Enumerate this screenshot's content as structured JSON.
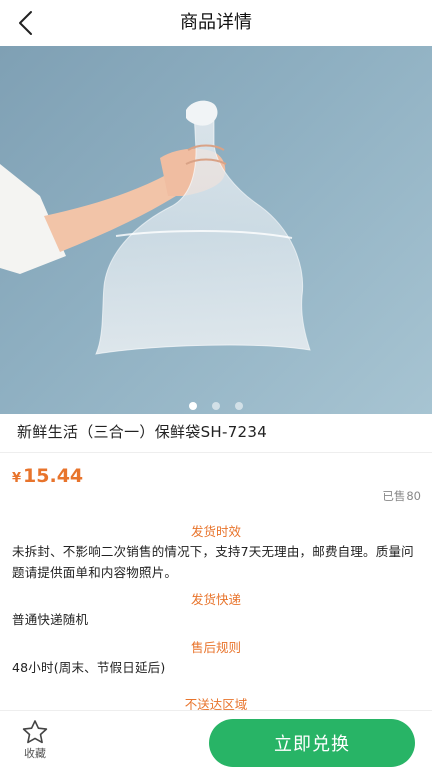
{
  "header": {
    "title": "商品详情",
    "back_icon": "chevron-left-icon"
  },
  "banner": {
    "slide_count": 3,
    "active_index": 0
  },
  "product": {
    "name": "新鲜生活（三合一）保鲜袋SH-7234",
    "currency": "¥",
    "price": "15.44",
    "sold_label": "已售",
    "sold_count": "80"
  },
  "sections": [
    {
      "title": "发货时效",
      "text": "未拆封、不影响二次销售的情况下，支持7天无理由，邮费自理。质量问题请提供面单和内容物照片。"
    },
    {
      "title": "发货快递",
      "text": "普通快递随机"
    },
    {
      "title": "售后规则",
      "text": "48小时(周末、节假日延后)"
    },
    {
      "title": "不送达区域",
      "text": ""
    }
  ],
  "bottom": {
    "favorite_label": "收藏",
    "favorite_icon": "star-outline-icon",
    "redeem_label": "立即兑换"
  },
  "colors": {
    "accent": "#e8742c",
    "button": "#28b466"
  }
}
